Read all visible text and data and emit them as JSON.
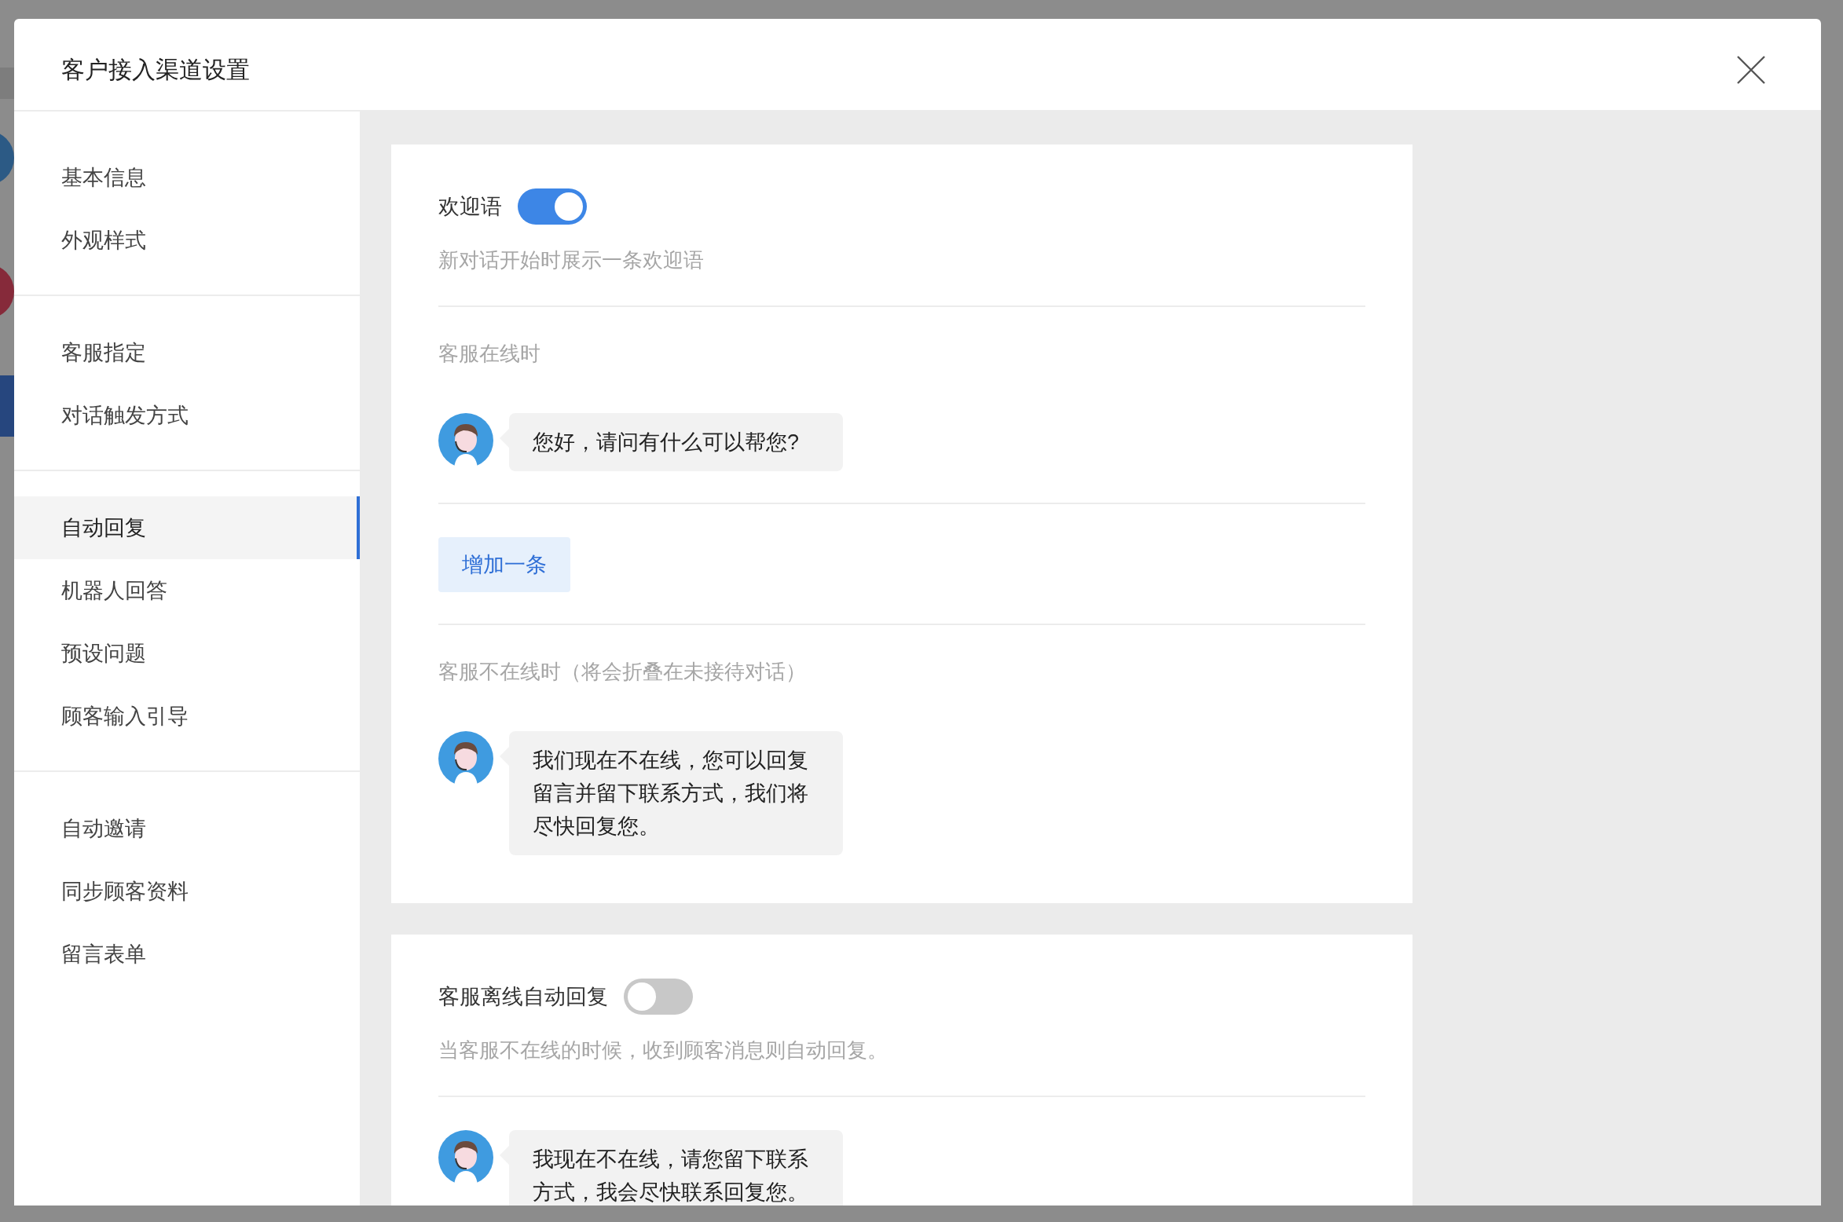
{
  "dialog": {
    "title": "客户接入渠道设置"
  },
  "sidebar": {
    "groups": [
      {
        "items": [
          {
            "label": "基本信息",
            "selected": false
          },
          {
            "label": "外观样式",
            "selected": false
          }
        ]
      },
      {
        "items": [
          {
            "label": "客服指定",
            "selected": false
          },
          {
            "label": "对话触发方式",
            "selected": false
          }
        ]
      },
      {
        "items": [
          {
            "label": "自动回复",
            "selected": true
          },
          {
            "label": "机器人回答",
            "selected": false
          },
          {
            "label": "预设问题",
            "selected": false
          },
          {
            "label": "顾客输入引导",
            "selected": false
          }
        ]
      },
      {
        "items": [
          {
            "label": "自动邀请",
            "selected": false
          },
          {
            "label": "同步顾客资料",
            "selected": false
          },
          {
            "label": "留言表单",
            "selected": false
          }
        ]
      }
    ]
  },
  "sections": [
    {
      "title": "欢迎语",
      "on": true,
      "description": "新对话开始时展示一条欢迎语",
      "blocks": [
        {
          "kind": "heading",
          "text": "客服在线时"
        },
        {
          "kind": "message",
          "text": "您好，请问有什么可以帮您?"
        },
        {
          "kind": "add_button",
          "text": "增加一条"
        },
        {
          "kind": "heading",
          "text": "客服不在线时（将会折叠在未接待对话）"
        },
        {
          "kind": "message",
          "text": "我们现在不在线，您可以回复留言并留下联系方式，我们将尽快回复您。"
        }
      ]
    },
    {
      "title": "客服离线自动回复",
      "on": false,
      "description": "当客服不在线的时候，收到顾客消息则自动回复。",
      "blocks": [
        {
          "kind": "message",
          "text": "我现在不在线，请您留下联系方式，我会尽快联系回复您。"
        }
      ]
    }
  ]
}
